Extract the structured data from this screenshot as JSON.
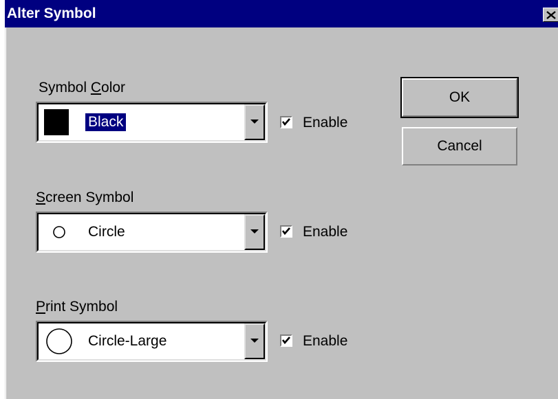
{
  "window": {
    "title": "Alter Symbol"
  },
  "symbol_color": {
    "label_mnemonic_prefix": "Symbol ",
    "label_mnemonic": "C",
    "label_suffix": "olor",
    "value": "Black",
    "swatch_color": "#000000",
    "enable_label": "Enable",
    "enabled": true
  },
  "screen_symbol": {
    "label_mnemonic": "S",
    "label_suffix": "creen Symbol",
    "value": "Circle",
    "icon": "small-circle-icon",
    "enable_label": "Enable",
    "enabled": true
  },
  "print_symbol": {
    "label_mnemonic": "P",
    "label_suffix": "rint Symbol",
    "value": "Circle-Large",
    "icon": "large-circle-icon",
    "enable_label": "Enable",
    "enabled": true
  },
  "buttons": {
    "ok": "OK",
    "cancel": "Cancel"
  },
  "colors": {
    "titlebar": "#000080",
    "dialog_face": "#c0c0c0",
    "selection": "#000080"
  }
}
